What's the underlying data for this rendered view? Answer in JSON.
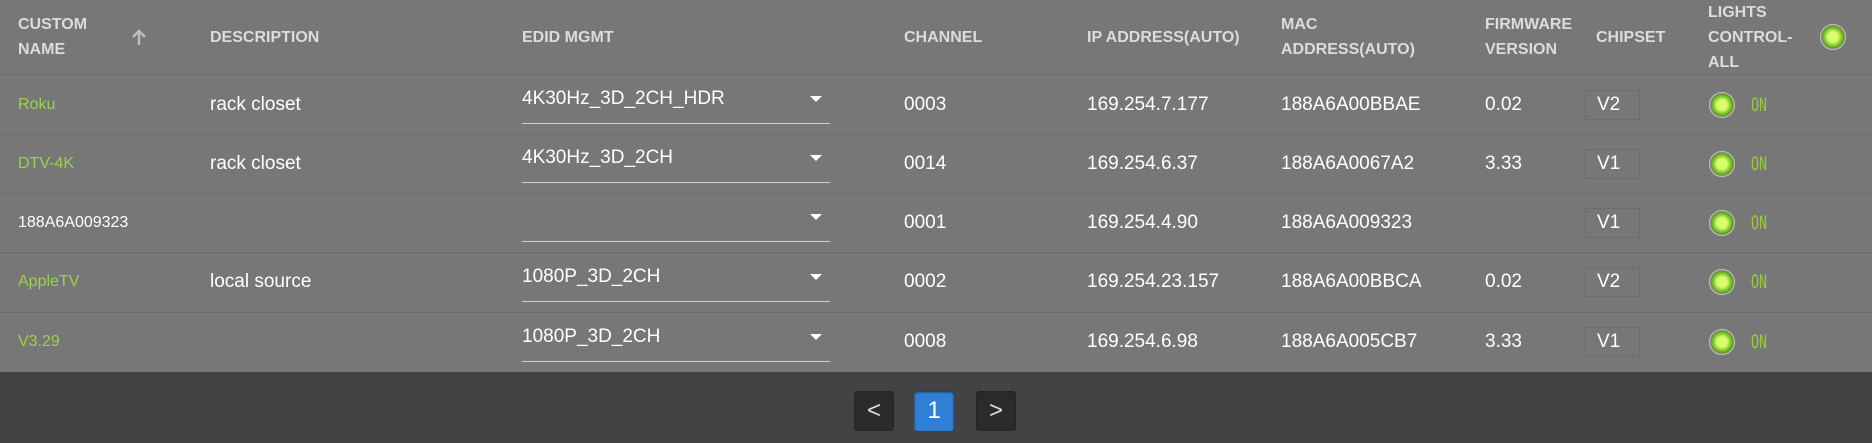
{
  "colors": {
    "green": "#9ad24a",
    "on": "#99cc33",
    "page_active": "#2f7fd6"
  },
  "header": {
    "custom_name": "CUSTOM NAME",
    "description": "DESCRIPTION",
    "edid": "EDID MGMT",
    "channel": "CHANNEL",
    "ip": "IP ADDRESS(AUTO)",
    "mac": "MAC ADDRESS(AUTO)",
    "firmware": "FIRMWARE VERSION",
    "chipset": "CHIPSET",
    "lights": "LIGHTS CONTROL-ALL",
    "sort_icon": "arrow-up-icon",
    "lights_icon": "led-indicator-icon"
  },
  "rows": [
    {
      "name": "Roku",
      "name_style": "green",
      "description": "rack closet",
      "edid": "4K30Hz_3D_2CH_HDR",
      "channel": "0003",
      "ip": "169.254.7.177",
      "mac": "188A6A00BBAE",
      "firmware": "0.02",
      "chipset": "V2",
      "light": "ON"
    },
    {
      "name": "DTV-4K",
      "name_style": "green",
      "description": "rack closet",
      "edid": "4K30Hz_3D_2CH",
      "channel": "0014",
      "ip": "169.254.6.37",
      "mac": "188A6A0067A2",
      "firmware": "3.33",
      "chipset": "V1",
      "light": "ON"
    },
    {
      "name": "188A6A009323",
      "name_style": "plain",
      "description": "",
      "edid": "",
      "channel": "0001",
      "ip": "169.254.4.90",
      "mac": "188A6A009323",
      "firmware": "",
      "chipset": "V1",
      "light": "ON"
    },
    {
      "name": "AppleTV",
      "name_style": "green",
      "description": "local source",
      "edid": "1080P_3D_2CH",
      "channel": "0002",
      "ip": "169.254.23.157",
      "mac": "188A6A00BBCA",
      "firmware": "0.02",
      "chipset": "V2",
      "light": "ON"
    },
    {
      "name": "V3.29",
      "name_style": "green",
      "description": "",
      "edid": "1080P_3D_2CH",
      "channel": "0008",
      "ip": "169.254.6.98",
      "mac": "188A6A005CB7",
      "firmware": "3.33",
      "chipset": "V1",
      "light": "ON"
    }
  ],
  "pagination": {
    "prev": "<",
    "current": "1",
    "next": ">"
  }
}
